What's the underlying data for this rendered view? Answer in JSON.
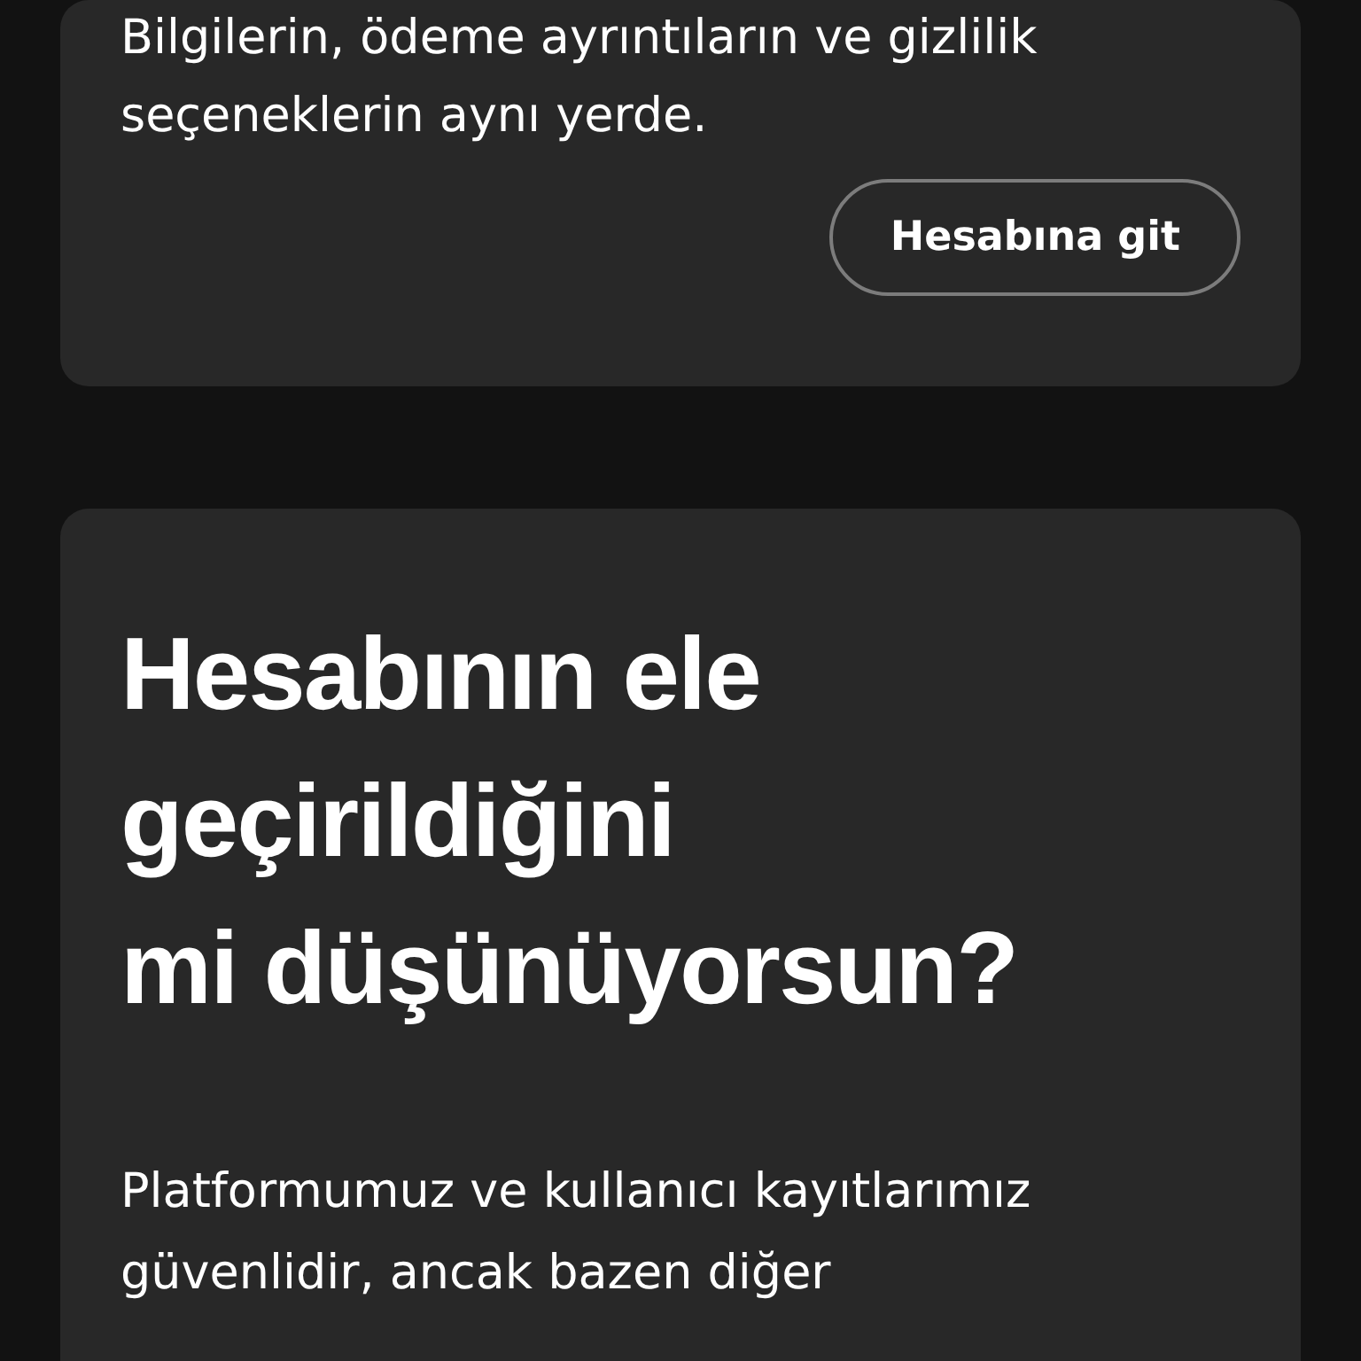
{
  "account_card": {
    "description": "Bilgilerin, ödeme ayrıntıların ve gizlilik seçeneklerin aynı yerde.",
    "button": "Hesabına git"
  },
  "security_card": {
    "heading": "Hesabının ele\ngeçirildiğini\nmi düşünüyorsun?",
    "body": "Platformumuz ve kullanıcı kayıtlarımız güvenlidir, ancak bazen diğer"
  }
}
